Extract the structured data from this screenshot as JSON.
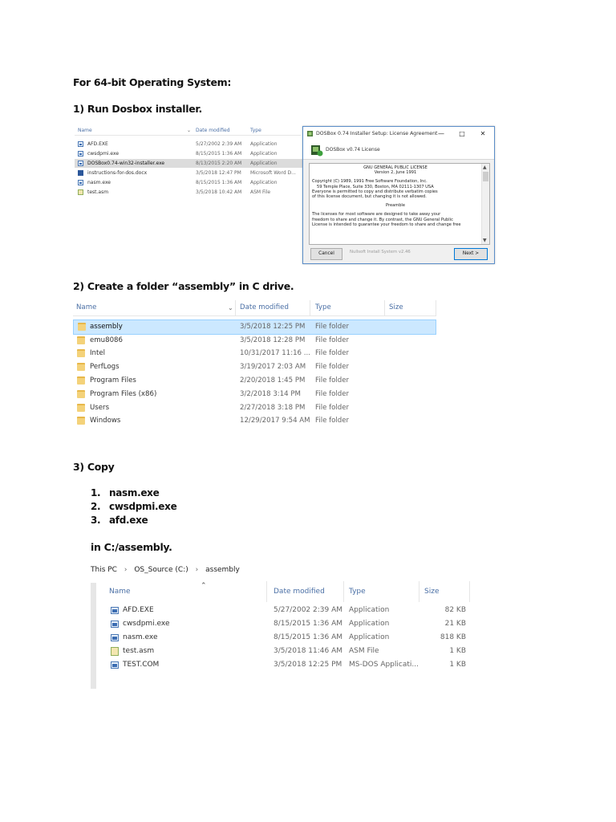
{
  "heading_64bit": "For 64-bit Operating System:",
  "step1": "1)  Run Dosbox installer.",
  "step2": "2)  Create a folder “assembly” in C drive.",
  "step3": "3) Copy",
  "copy_items": [
    "1.",
    "nasm.exe",
    "2.",
    "cwsdpmi.exe",
    "3.",
    "afd.exe"
  ],
  "copy_dest": "in C:/assembly.",
  "explorer1": {
    "columns": [
      "Name",
      "Date modified",
      "Type"
    ],
    "rows": [
      {
        "name": "AFD.EXE",
        "date": "5/27/2002 2:39 AM",
        "type": "Application"
      },
      {
        "name": "cwsdpmi.exe",
        "date": "8/15/2015 1:36 AM",
        "type": "Application"
      },
      {
        "name": "DOSBox0.74-win32-installer.exe",
        "date": "8/13/2015 2:20 AM",
        "type": "Application"
      },
      {
        "name": "instructions-for-dos.docx",
        "date": "3/5/2018 12:47 PM",
        "type": "Microsoft Word D..."
      },
      {
        "name": "nasm.exe",
        "date": "8/15/2015 1:36 AM",
        "type": "Application"
      },
      {
        "name": "test.asm",
        "date": "3/5/2018 10:42 AM",
        "type": "ASM File"
      }
    ]
  },
  "dialog": {
    "title": "DOSBox 0.74 Installer Setup: License Agreement",
    "min": "—",
    "max": "□",
    "close": "✕",
    "banner": "DOSBox v0.74 License",
    "license_lines": [
      "GNU GENERAL PUBLIC LICENSE",
      "Version 2, June 1991",
      "Copyright (C) 1989, 1991 Free Software Foundation, Inc.",
      "59 Temple Place, Suite 330, Boston, MA  02111-1307  USA",
      "Everyone is permitted to copy and distribute verbatim copies",
      "of this license document, but changing it is not allowed.",
      "Preamble",
      "The licenses for most software are designed to take away your",
      "freedom to share and change it.  By contrast, the GNU General Public",
      "License is intended to guarantee your freedom to share and change free"
    ],
    "cancel": "Cancel",
    "footer": "Nullsoft Install System v2.46",
    "next": "Next >"
  },
  "explorer2": {
    "columns": [
      "Name",
      "Date modified",
      "Type",
      "Size"
    ],
    "rows": [
      {
        "name": "assembly",
        "date": "3/5/2018 12:25 PM",
        "type": "File folder"
      },
      {
        "name": "emu8086",
        "date": "3/5/2018 12:28 PM",
        "type": "File folder"
      },
      {
        "name": "Intel",
        "date": "10/31/2017 11:16 ...",
        "type": "File folder"
      },
      {
        "name": "PerfLogs",
        "date": "3/19/2017 2:03 AM",
        "type": "File folder"
      },
      {
        "name": "Program Files",
        "date": "2/20/2018 1:45 PM",
        "type": "File folder"
      },
      {
        "name": "Program Files (x86)",
        "date": "3/2/2018 3:14 PM",
        "type": "File folder"
      },
      {
        "name": "Users",
        "date": "2/27/2018 3:18 PM",
        "type": "File folder"
      },
      {
        "name": "Windows",
        "date": "12/29/2017 9:54 AM",
        "type": "File folder"
      }
    ]
  },
  "explorer3": {
    "breadcrumb": [
      "This PC",
      "OS_Source (C:)",
      "assembly"
    ],
    "columns": [
      "Name",
      "Date modified",
      "Type",
      "Size"
    ],
    "rows": [
      {
        "name": "AFD.EXE",
        "date": "5/27/2002 2:39 AM",
        "type": "Application",
        "size": "82 KB"
      },
      {
        "name": "cwsdpmi.exe",
        "date": "8/15/2015 1:36 AM",
        "type": "Application",
        "size": "21 KB"
      },
      {
        "name": "nasm.exe",
        "date": "8/15/2015 1:36 AM",
        "type": "Application",
        "size": "818 KB"
      },
      {
        "name": "test.asm",
        "date": "3/5/2018 11:46 AM",
        "type": "ASM File",
        "size": "1 KB"
      },
      {
        "name": "TEST.COM",
        "date": "3/5/2018 12:25 PM",
        "type": "MS-DOS Applicati...",
        "size": "1 KB"
      }
    ]
  }
}
